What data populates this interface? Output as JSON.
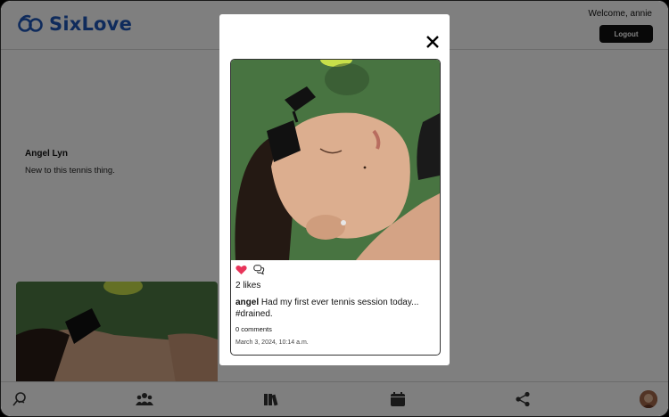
{
  "app": {
    "name": "SixLove",
    "brand_color": "#1e56b8",
    "welcome": "Welcome, annie",
    "logout_label": "Logout"
  },
  "profile": {
    "name": "Angel Lyn",
    "bio": "New to this tennis thing."
  },
  "modal": {
    "post": {
      "likes_text": "2 likes",
      "liked": true,
      "author": "angel",
      "caption": "Had my first ever tennis session today... #drained.",
      "comments_text": "0 comments",
      "date": "March 3, 2024, 10:14 a.m."
    }
  },
  "nav": {
    "items": [
      "search-user-icon",
      "community-icon",
      "library-icon",
      "calendar-icon",
      "share-icon",
      "user-avatar"
    ]
  },
  "colors": {
    "heart": "#e8345a",
    "overlay": "rgba(0,0,0,0.5)",
    "court_green": "#4e7a45"
  }
}
